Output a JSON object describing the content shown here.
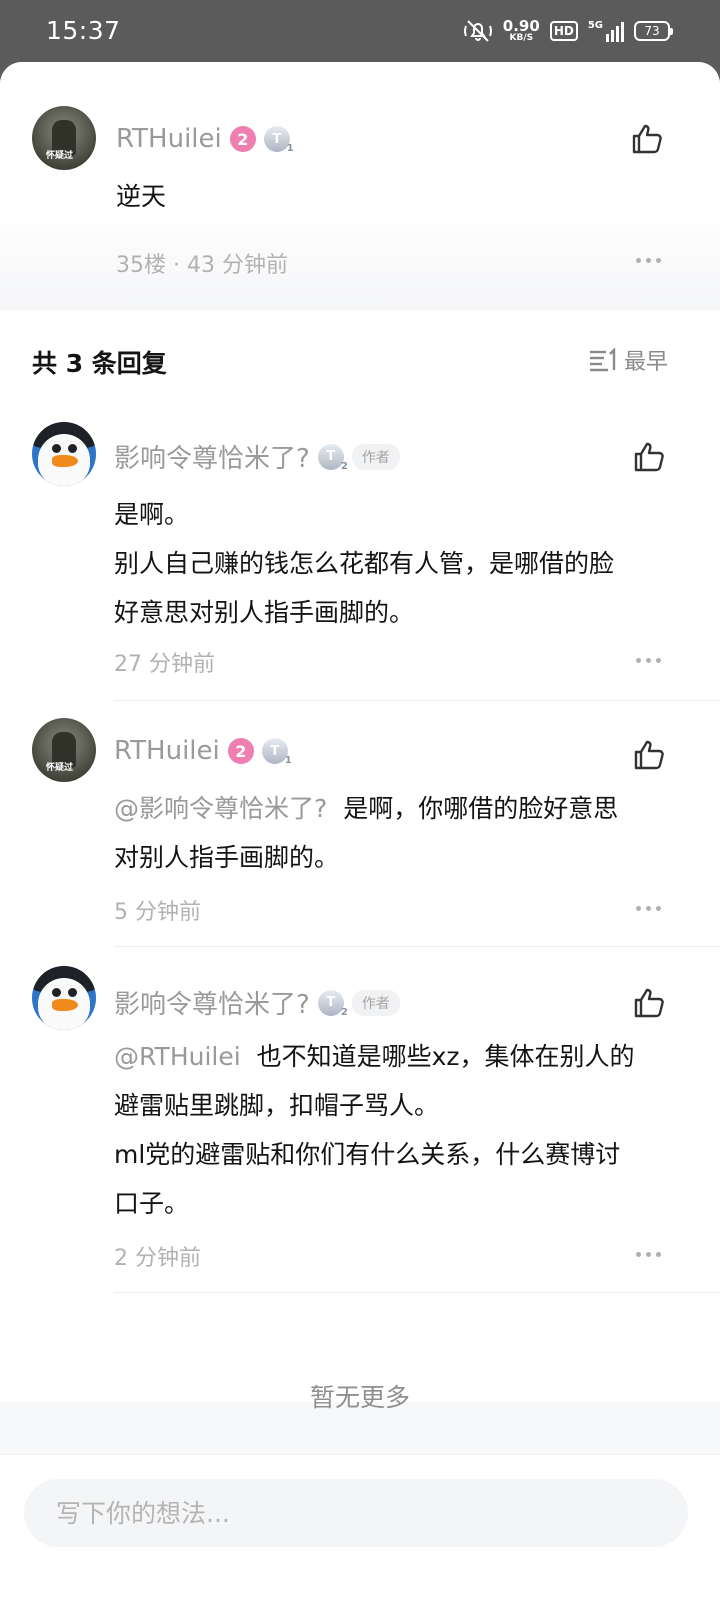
{
  "status_bar": {
    "time": "15:37",
    "net_speed": "0.90",
    "net_unit": "KB/S",
    "hd": "HD",
    "network": "5G",
    "battery": "73"
  },
  "main_comment": {
    "username": "RTHuilei",
    "level": "2",
    "badge": "T",
    "badge_sub": "1",
    "avatar_text": "怀疑过",
    "content": "逆天",
    "meta": "35楼 · 43 分钟前"
  },
  "replies_header": {
    "count_label": "共 3 条回复",
    "sort_label": "最早"
  },
  "replies": [
    {
      "username": "影响令尊恰米了?",
      "badge": "T",
      "badge_sub": "2",
      "author_tag": "作者",
      "lines": [
        "是啊。",
        "别人自己赚的钱怎么花都有人管，是哪借的脸",
        "好意思对别人指手画脚的。"
      ],
      "meta": "27 分钟前"
    },
    {
      "username": "RTHuilei",
      "level": "2",
      "badge": "T",
      "badge_sub": "1",
      "avatar_text": "怀疑过",
      "mention": "@影响令尊恰米了?",
      "lines": [
        "是啊，你哪借的脸好意思",
        "对别人指手画脚的。"
      ],
      "meta": "5 分钟前"
    },
    {
      "username": "影响令尊恰米了?",
      "badge": "T",
      "badge_sub": "2",
      "author_tag": "作者",
      "mention": "@RTHuilei",
      "lines": [
        "也不知道是哪些xz，集体在别人的",
        "避雷贴里跳脚，扣帽子骂人。",
        "ml党的避雷贴和你们有什么关系，什么赛博讨",
        "口子。"
      ],
      "meta": "2 分钟前"
    }
  ],
  "no_more": "暂无更多",
  "input": {
    "placeholder": "写下你的想法..."
  }
}
